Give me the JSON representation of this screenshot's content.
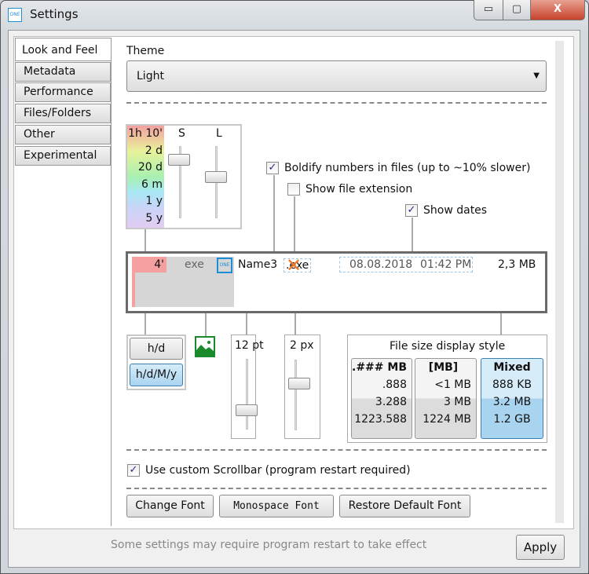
{
  "window": {
    "title": "Settings",
    "app_icon": "ONE",
    "controls": {
      "minimize": "▭",
      "maximize": "▢",
      "close": "X"
    }
  },
  "tabs": [
    {
      "label": "Look and Feel",
      "selected": true
    },
    {
      "label": "Metadata"
    },
    {
      "label": "Performance"
    },
    {
      "label": "Files/Folders"
    },
    {
      "label": "Other"
    },
    {
      "label": "Experimental"
    }
  ],
  "theme": {
    "label": "Theme",
    "value": "Light"
  },
  "age_colors": {
    "labels": [
      "1h 10'",
      "2 d",
      "20 d",
      "6 m",
      "1 y",
      "5 y"
    ],
    "s_label": "S",
    "l_label": "L",
    "s_value": 0.85,
    "l_value": 0.6
  },
  "options": {
    "boldify": {
      "label": "Boldify numbers in files (up to ~10% slower)",
      "checked": true
    },
    "show_extension": {
      "label": "Show file extension",
      "checked": false
    },
    "show_dates": {
      "label": "Show dates",
      "checked": true
    }
  },
  "preview": {
    "age": "4'",
    "ext": "exe",
    "icon": "ONE",
    "name": "Name3",
    "ext_crossed": ".exe",
    "date": "08.08.2018",
    "time": "01:42 PM",
    "size": "2,3 MB"
  },
  "date_format": {
    "options": [
      "h/d",
      "h/d/M/y"
    ],
    "selected": "h/d/M/y"
  },
  "font_size": {
    "value": "12 pt",
    "level": 0.25
  },
  "padding": {
    "value": "2 px",
    "level": 0.7
  },
  "file_size_style": {
    "title": "File size display style",
    "options": [
      {
        "header": ".### MB",
        "rows": [
          ".888",
          "3.288",
          "1223.588"
        ]
      },
      {
        "header": "[MB]",
        "rows": [
          "<1 MB",
          "3 MB",
          "1224 MB"
        ]
      },
      {
        "header": "Mixed",
        "rows": [
          "888 KB",
          "3.2 MB",
          "1.2 GB"
        ],
        "selected": true
      }
    ]
  },
  "custom_scrollbar": {
    "label": "Use custom Scrollbar (program restart required)",
    "checked": true
  },
  "font_buttons": {
    "change": "Change Font",
    "mono": "Monospace Font",
    "restore": "Restore Default Font"
  },
  "footer": {
    "note": "Some settings may require program restart to take effect",
    "apply": "Apply"
  },
  "colors": {
    "accent": "#bfe0f5",
    "age_new": "#f4a0a0"
  }
}
